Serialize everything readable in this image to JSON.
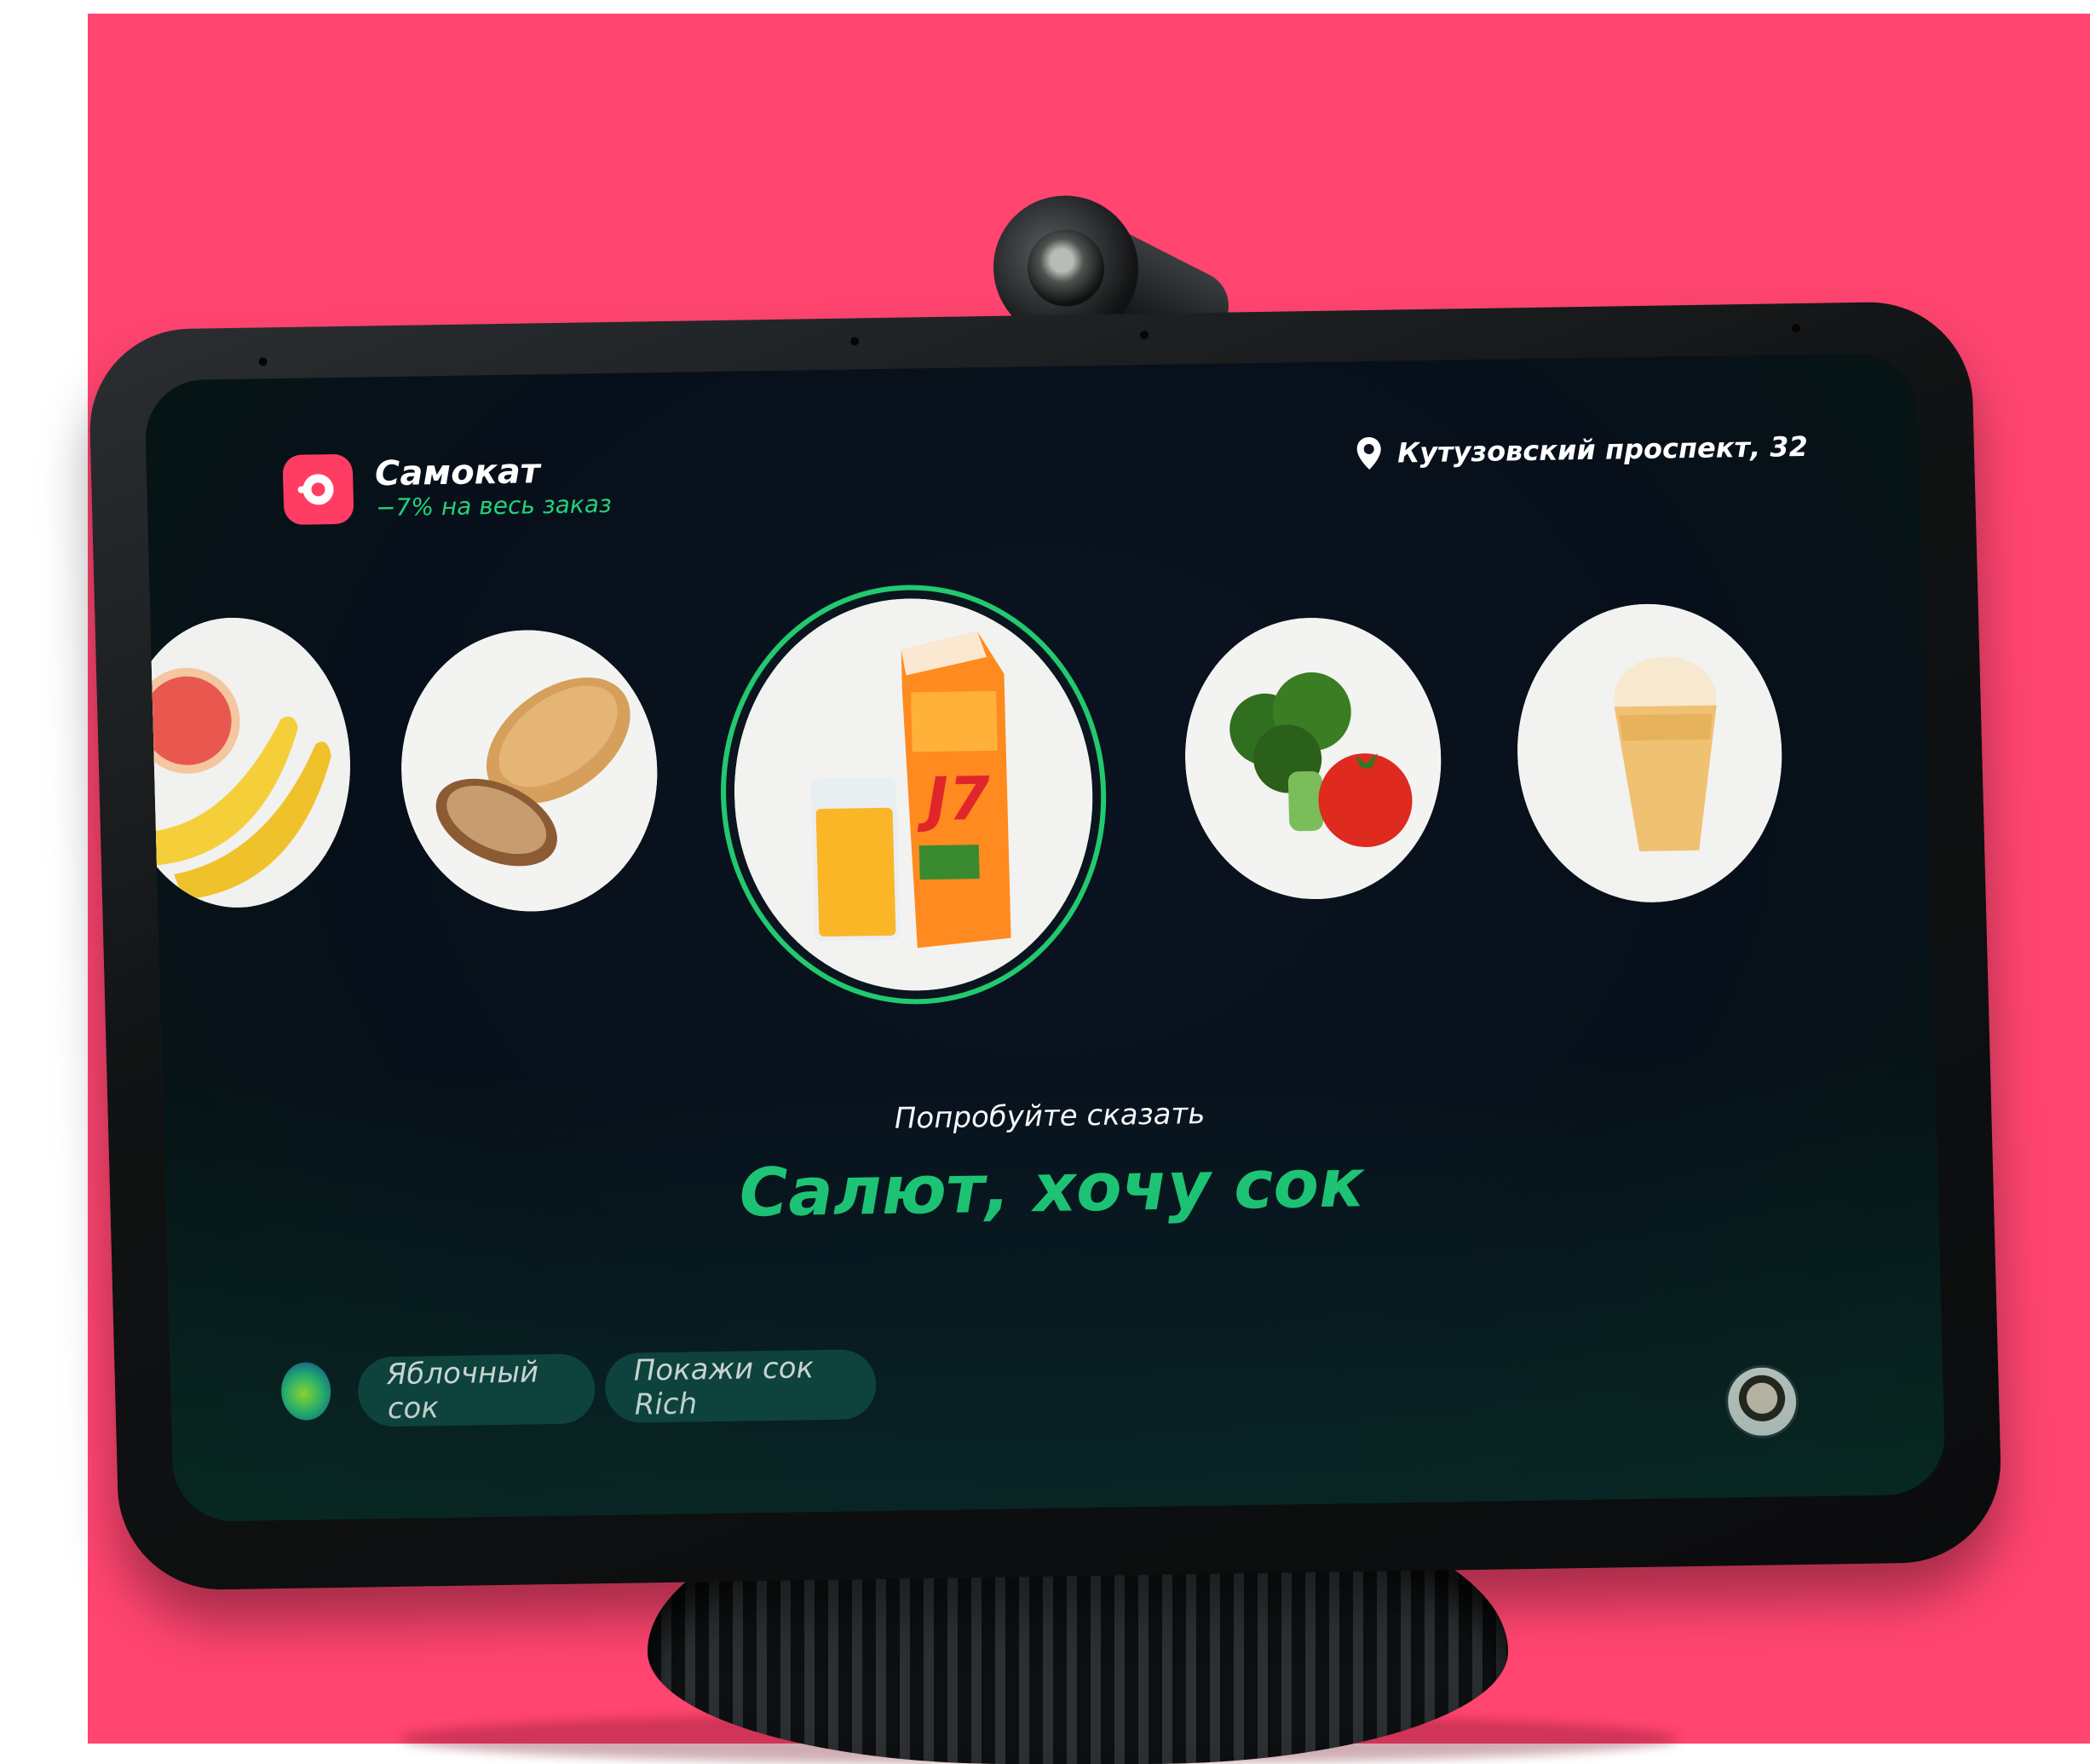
{
  "brand": {
    "name": "Самокат",
    "promo": "−7% на весь заказ",
    "accent": "#ff3d64"
  },
  "location": {
    "address": "Кутузовский проспект, 32",
    "icon": "location-pin-icon"
  },
  "carousel": {
    "items": [
      {
        "product": "grapefruit-banana",
        "selected": false
      },
      {
        "product": "bread",
        "selected": false
      },
      {
        "product": "orange-juice",
        "selected": true,
        "brand_label": "J7"
      },
      {
        "product": "broccoli-tomato",
        "selected": false
      },
      {
        "product": "ice-cream",
        "selected": false
      }
    ],
    "selected_ring_color": "#22c96f"
  },
  "prompt": {
    "hint": "Попробуйте сказать",
    "phrase": "Салют, хочу сок",
    "phrase_color": "#1fd07a"
  },
  "suggestions": [
    {
      "label": "Яблочный сок"
    },
    {
      "label": "Покажи сок Rich"
    }
  ],
  "background_color": "#ff4570"
}
